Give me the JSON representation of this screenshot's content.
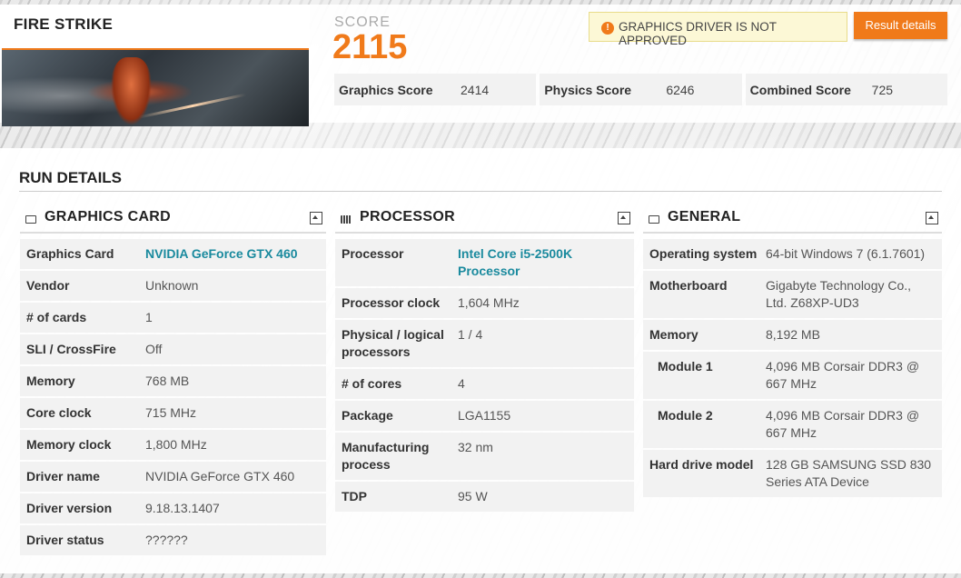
{
  "benchmark": {
    "title": "FIRE STRIKE"
  },
  "score": {
    "label": "SCORE",
    "value": "2115"
  },
  "warning": {
    "text": "GRAPHICS DRIVER IS NOT APPROVED"
  },
  "result_button": {
    "label": "Result details"
  },
  "subscores": [
    {
      "label": "Graphics Score",
      "value": "2414"
    },
    {
      "label": "Physics Score",
      "value": "6246"
    },
    {
      "label": "Combined Score",
      "value": "725"
    }
  ],
  "run_details": {
    "title": "RUN DETAILS",
    "graphics": {
      "title": "GRAPHICS CARD",
      "rows": [
        {
          "k": "Graphics Card",
          "v": "NVIDIA GeForce GTX 460"
        },
        {
          "k": "Vendor",
          "v": "Unknown"
        },
        {
          "k": "# of cards",
          "v": "1"
        },
        {
          "k": "SLI / CrossFire",
          "v": "Off"
        },
        {
          "k": "Memory",
          "v": "768 MB"
        },
        {
          "k": "Core clock",
          "v": "715 MHz"
        },
        {
          "k": "Memory clock",
          "v": "1,800 MHz"
        },
        {
          "k": "Driver name",
          "v": "NVIDIA GeForce GTX 460"
        },
        {
          "k": "Driver version",
          "v": "9.18.13.1407"
        },
        {
          "k": "Driver status",
          "v": "??????"
        }
      ]
    },
    "processor": {
      "title": "PROCESSOR",
      "rows": [
        {
          "k": "Processor",
          "v": "Intel Core i5-2500K Processor"
        },
        {
          "k": "Processor clock",
          "v": "1,604 MHz"
        },
        {
          "k": "Physical / logical processors",
          "v": "1 / 4"
        },
        {
          "k": "# of cores",
          "v": "4"
        },
        {
          "k": "Package",
          "v": "LGA1155"
        },
        {
          "k": "Manufacturing process",
          "v": "32 nm"
        },
        {
          "k": "TDP",
          "v": "95 W"
        }
      ]
    },
    "general": {
      "title": "GENERAL",
      "rows": [
        {
          "k": "Operating system",
          "v": "64-bit Windows 7 (6.1.7601)"
        },
        {
          "k": "Motherboard",
          "v": "Gigabyte Technology Co., Ltd. Z68XP-UD3"
        },
        {
          "k": "Memory",
          "v": "8,192 MB"
        },
        {
          "k": "Module 1",
          "v": "4,096 MB Corsair DDR3 @ 667 MHz"
        },
        {
          "k": "Module 2",
          "v": "4,096 MB Corsair DDR3 @ 667 MHz"
        },
        {
          "k": "Hard drive model",
          "v": "128 GB SAMSUNG SSD 830 Series ATA Device"
        }
      ]
    }
  }
}
